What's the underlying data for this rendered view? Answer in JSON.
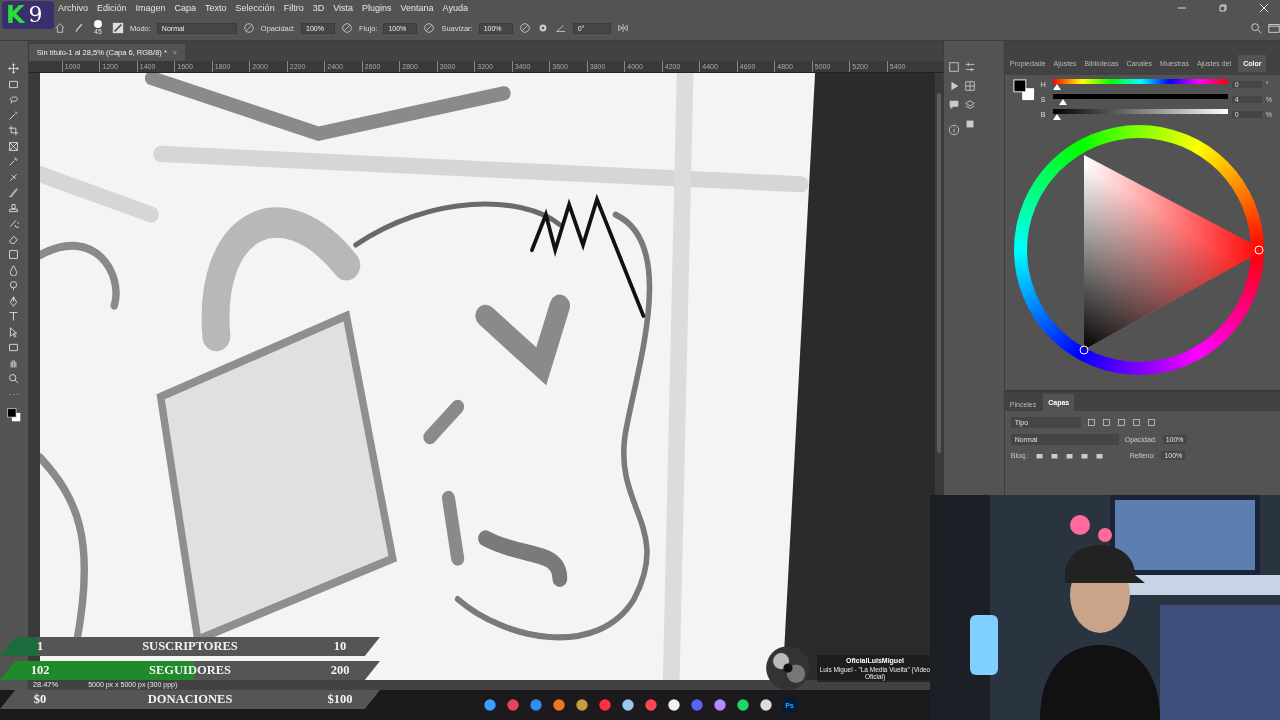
{
  "app_bar": {
    "logo": {
      "letter": "K",
      "number": "9"
    },
    "menu": [
      "Archivo",
      "Edición",
      "Imagen",
      "Capa",
      "Texto",
      "Selección",
      "Filtro",
      "3D",
      "Vista",
      "Plugins",
      "Ventana",
      "Ayuda"
    ]
  },
  "options_bar": {
    "brush_size": "45",
    "angle": "0°",
    "fields": [
      {
        "label": "Modo:",
        "value": "Normal",
        "kind": "wide"
      },
      {
        "label": "Opacidad:",
        "value": "100%",
        "kind": "narrow"
      },
      {
        "label": "Flujo:",
        "value": "100%",
        "kind": "narrow"
      },
      {
        "label": "Suavizar:",
        "value": "100%",
        "kind": "narrow"
      }
    ]
  },
  "document": {
    "tab": "Sin título-1 al 28,5% (Capa 6, RGB/8) *",
    "close": "×",
    "ruler": [
      "1000",
      "1200",
      "1400",
      "1600",
      "1800",
      "2000",
      "2200",
      "2400",
      "2600",
      "2800",
      "3000",
      "3200",
      "3400",
      "3600",
      "3800",
      "4000",
      "4200",
      "4400",
      "4600",
      "4800",
      "5000",
      "5200",
      "5400"
    ]
  },
  "status_bar": {
    "zoom": "28.47%",
    "size": "5000 px x 5000 px (300 ppp)"
  },
  "color_panel": {
    "tabs": [
      {
        "label": "Propiedade",
        "selected": false
      },
      {
        "label": "Ajustes",
        "selected": false
      },
      {
        "label": "Bibliotecas",
        "selected": false
      },
      {
        "label": "Canales",
        "selected": false
      },
      {
        "label": "Muestras",
        "selected": false
      },
      {
        "label": "Ajustes del",
        "selected": false
      },
      {
        "label": "Color",
        "selected": true
      }
    ],
    "sliders": [
      {
        "label": "H",
        "value": "0",
        "unit": "°",
        "level": 0,
        "kind": "hue"
      },
      {
        "label": "S",
        "value": "4",
        "unit": "%",
        "level": 0.04,
        "kind": "saturation"
      },
      {
        "label": "B",
        "value": "0",
        "unit": "%",
        "level": 0,
        "kind": "brightness"
      }
    ]
  },
  "layers_panel": {
    "tabs": [
      {
        "label": "Pinceles",
        "selected": false
      },
      {
        "label": "Capas",
        "selected": true
      }
    ],
    "filter": "Tipo",
    "blend_mode": "Normal",
    "opacity_label": "Opacidad:",
    "opacity": "100%",
    "lock_label": "Bloq.:",
    "fill_label": "Relleno:",
    "fill": "100%"
  },
  "stream_overlay": {
    "goals": [
      {
        "current": "1",
        "label": "SUSCRIPTORES",
        "target": "10",
        "level": 0.1,
        "color": "#1d6b3c"
      },
      {
        "current": "102",
        "label": "SEGUIDORES",
        "target": "200",
        "level": 0.51,
        "color": "#1f8a2a"
      },
      {
        "current": "$0",
        "label": "DONACIONES",
        "target": "$100",
        "level": 0
      }
    ]
  },
  "now_playing": {
    "channel": "OficialLuisMiguel",
    "title": "Luis Miguel - \"La Media Vuelta\" (Video Oficial)"
  },
  "taskbar": {
    "ps_label": "Ps"
  }
}
